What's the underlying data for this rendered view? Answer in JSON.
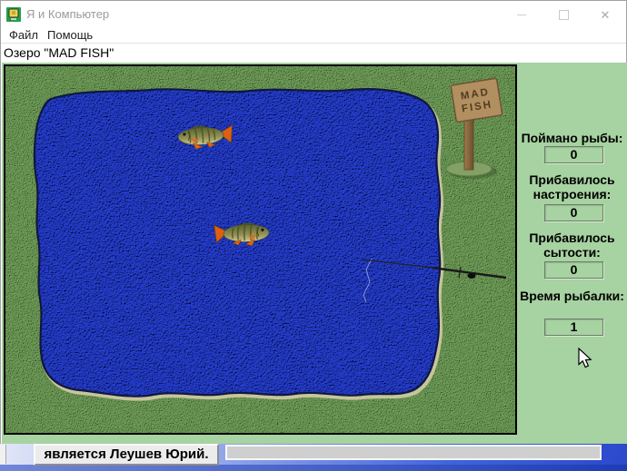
{
  "window": {
    "title": "Я и Компьютер",
    "controls": {
      "close_glyph": "✕"
    }
  },
  "icons": {
    "app_icon": "computer-icon",
    "minimize": "minimize-icon",
    "maximize": "maximize-icon",
    "close": "close-icon",
    "cursor": "arrow-cursor"
  },
  "menu": {
    "items": [
      {
        "label": "Файл"
      },
      {
        "label": "Помощь"
      }
    ]
  },
  "location_bar": {
    "label": "Озеро \"MAD FISH\""
  },
  "game": {
    "sign": {
      "line1": "MAD",
      "line2": "FISH"
    },
    "fish_visible": 2
  },
  "stats": {
    "items": [
      {
        "label": "Поймано рыбы:",
        "value": "0"
      },
      {
        "label": "Прибавилось настроения:",
        "value": "0"
      },
      {
        "label": "Прибавилось сытости:",
        "value": "0"
      },
      {
        "label": "Время рыбалки:",
        "value": "1"
      }
    ]
  },
  "ticker": {
    "text": "является Леушев Юрий."
  },
  "colors": {
    "client_green": "#a7d2a1",
    "grass_green": "#74a45c",
    "lake_blue": "#2741d8",
    "band_blue": "#3a5ede",
    "sign_wood": "#b28f60"
  }
}
